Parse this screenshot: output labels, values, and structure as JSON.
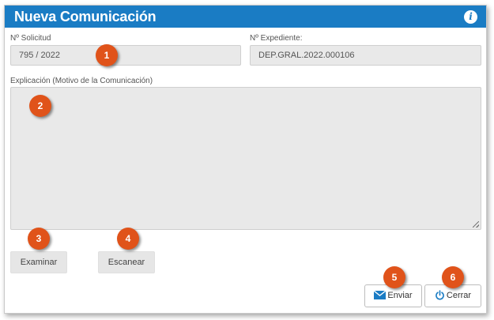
{
  "dialog": {
    "title": "Nueva Comunicación",
    "info_icon": "info-icon"
  },
  "form": {
    "solicitud": {
      "label": "Nº Solicitud",
      "value": "795 / 2022"
    },
    "expediente": {
      "label": "Nº Expediente:",
      "value": "DEP.GRAL.2022.000106"
    },
    "explicacion": {
      "label": "Explicación (Motivo de la Comunicación)",
      "value": ""
    }
  },
  "buttons": {
    "examinar": "Examinar",
    "escanear": "Escanear",
    "enviar": {
      "label": "Enviar",
      "icon": "envelope-icon"
    },
    "cerrar": {
      "label": "Cerrar",
      "icon": "power-icon"
    }
  },
  "callouts": [
    "1",
    "2",
    "3",
    "4",
    "5",
    "6"
  ],
  "colors": {
    "titlebar": "#1a7cc4",
    "callout": "#e0531a"
  }
}
